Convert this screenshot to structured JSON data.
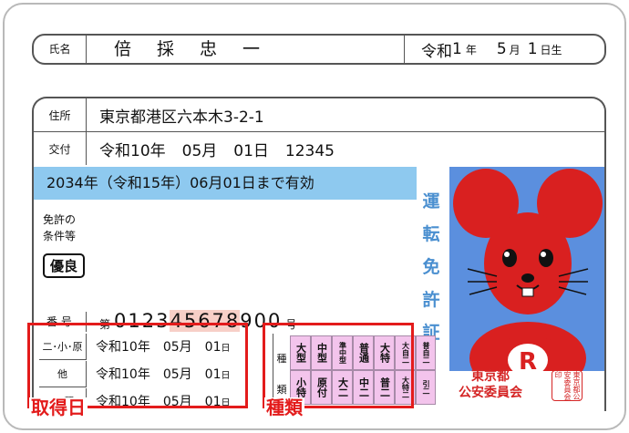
{
  "name_row": {
    "label": "氏名",
    "name": "倍採忠一",
    "birth_era": "令和",
    "birth_year": "1",
    "birth_year_unit": "年",
    "birth_month": "5",
    "birth_month_unit": "月",
    "birth_day": "1",
    "birth_day_unit": "日生"
  },
  "address": {
    "label": "住所",
    "value": "東京都港区六本木3-2-1"
  },
  "issue": {
    "label": "交付",
    "date": "令和10年",
    "month": "05月",
    "day": "01日",
    "number": "12345"
  },
  "validity": "2034年（令和15年）06月01日まで有効",
  "conditions": {
    "label_line1": "免許の",
    "label_line2": "条件等",
    "badge": "優良"
  },
  "vertical_title": [
    "運",
    "転",
    "免",
    "許",
    "証"
  ],
  "license_number": {
    "label": "番 号",
    "prefix": "第",
    "digits_a": "0123",
    "digits_hl": "45678",
    "digits_b": "900",
    "suffix": "号"
  },
  "acquisition": [
    {
      "label": "二･小･原",
      "year": "令和10年",
      "month": "05月",
      "day": "01",
      "day_unit": "日"
    },
    {
      "label": "他",
      "year": "令和10年",
      "month": "05月",
      "day": "01",
      "day_unit": "日"
    },
    {
      "label": "二 種",
      "year": "令和10年",
      "month": "05月",
      "day": "01",
      "day_unit": "日"
    }
  ],
  "types_head": [
    "種",
    "類"
  ],
  "types_grid": [
    "大型",
    "中型",
    "準中型",
    "普通",
    "大特",
    "大自二",
    "普自二",
    "小特",
    "原付",
    "大二",
    "中二",
    "普二",
    "大特二",
    "引二"
  ],
  "issuer_line1": "東京都",
  "issuer_line2": "公安委員会",
  "seal": "東京都公安委員会印",
  "annotation_acq": "取得日",
  "annotation_types": "種類",
  "colors": {
    "validity_bg": "#8ec9ef",
    "photo_bg": "#5b8fde",
    "mouse": "#d92020",
    "accent_red": "#e31b1b",
    "type_cell": "#f3c4ec"
  }
}
